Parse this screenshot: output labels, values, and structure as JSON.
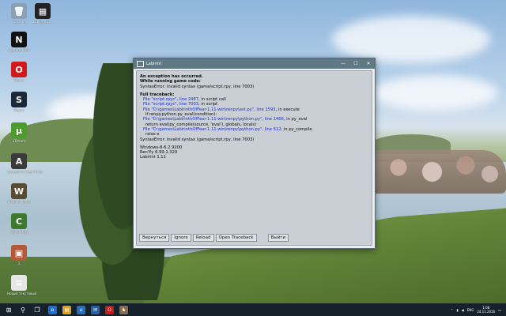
{
  "desktop": {
    "icons": [
      {
        "label": "Корзина",
        "glyph": "🗑",
        "color": "#8aa0b4"
      },
      {
        "label": "Labirinth1...",
        "glyph": "▦",
        "color": "#222"
      },
      {
        "label": "Capture NX-D",
        "glyph": "N",
        "color": "#111"
      },
      {
        "label": "Opera",
        "glyph": "O",
        "color": "#d01919"
      },
      {
        "label": "Steam",
        "glyph": "S",
        "color": "#1b2838"
      },
      {
        "label": "uTorrent",
        "glyph": "µ",
        "color": "#4c9c2e"
      },
      {
        "label": "Assassin's Creed Unity",
        "glyph": "A",
        "color": "#3a3a3a"
      },
      {
        "label": "World of Tanks",
        "glyph": "W",
        "color": "#5a4b33"
      },
      {
        "label": "Call of Duty",
        "glyph": "C",
        "color": "#3d7a2f"
      },
      {
        "label": "1",
        "glyph": "▣",
        "color": "#b35a3a"
      },
      {
        "label": "Новый текстовый",
        "glyph": "≡",
        "color": "#e6e6e6"
      }
    ]
  },
  "window": {
    "title": "Labirint",
    "controls": {
      "minimize": "—",
      "maximize": "☐",
      "close": "✕"
    },
    "lines": [
      {
        "text": "An exception has occurred.",
        "style": "h"
      },
      {
        "text": "While running game code:",
        "style": "h"
      },
      {
        "text": "SyntaxError: invalid syntax (game/script.rpy, line 7003)",
        "style": ""
      },
      {
        "text": "",
        "style": "gap"
      },
      {
        "text": "Full traceback:",
        "style": "h"
      },
      {
        "text": "File \"script.rpyc\", line 2487, in script call",
        "style": "ind1 mixed1"
      },
      {
        "text": "File \"script.rpyc\", line 7003, in script",
        "style": "ind1 mixed2"
      },
      {
        "text": "File \"D:\\games\\LabirinthOfFear-1.11-win\\renpy\\ast.py\", line 1593, in execute",
        "style": "ind1 mixed3"
      },
      {
        "text": "if renpy.python.py_eval(condition):",
        "style": "ind2"
      },
      {
        "text": "File \"D:\\games\\LabirinthOfFear-1.11-win\\renpy\\python.py\", line 1466, in py_eval",
        "style": "ind1 mixed4"
      },
      {
        "text": "return eval(py_compile(source, 'eval'), globals, locals)",
        "style": "ind2"
      },
      {
        "text": "File \"D:\\games\\LabirinthOfFear-1.11-win\\renpy\\python.py\", line 512, in py_compile",
        "style": "ind1 mixed5"
      },
      {
        "text": "raise e",
        "style": "ind2"
      },
      {
        "text": "SyntaxError: invalid syntax (game/script.rpy, line 7003)",
        "style": ""
      },
      {
        "text": "",
        "style": "gap"
      },
      {
        "text": "Windows-8-6.2.9200",
        "style": ""
      },
      {
        "text": "Ren'Py 6.99.1.329",
        "style": ""
      },
      {
        "text": "Labirint 1.11",
        "style": ""
      }
    ],
    "buttons": {
      "rollback": "Вернуться",
      "ignore": "Ignore",
      "reload": "Reload",
      "open_traceback": "Open Traceback",
      "exit": "Выйти"
    }
  },
  "taskbar": {
    "start_glyph": "⊞",
    "search_glyph": "⚲",
    "taskview_glyph": "❐",
    "apps": [
      {
        "glyph": "e",
        "color": "#1e6fc9"
      },
      {
        "glyph": "▤",
        "color": "#e0a21a"
      },
      {
        "glyph": "⌂",
        "color": "#2b6fb8"
      },
      {
        "glyph": "✉",
        "color": "#2a5fa5"
      },
      {
        "glyph": "O",
        "color": "#c81a1a"
      },
      {
        "glyph": "♞",
        "color": "#8a6a4a"
      }
    ],
    "tray": {
      "lang": "ENG",
      "time": "1:08",
      "date": "24.11.2016"
    }
  }
}
